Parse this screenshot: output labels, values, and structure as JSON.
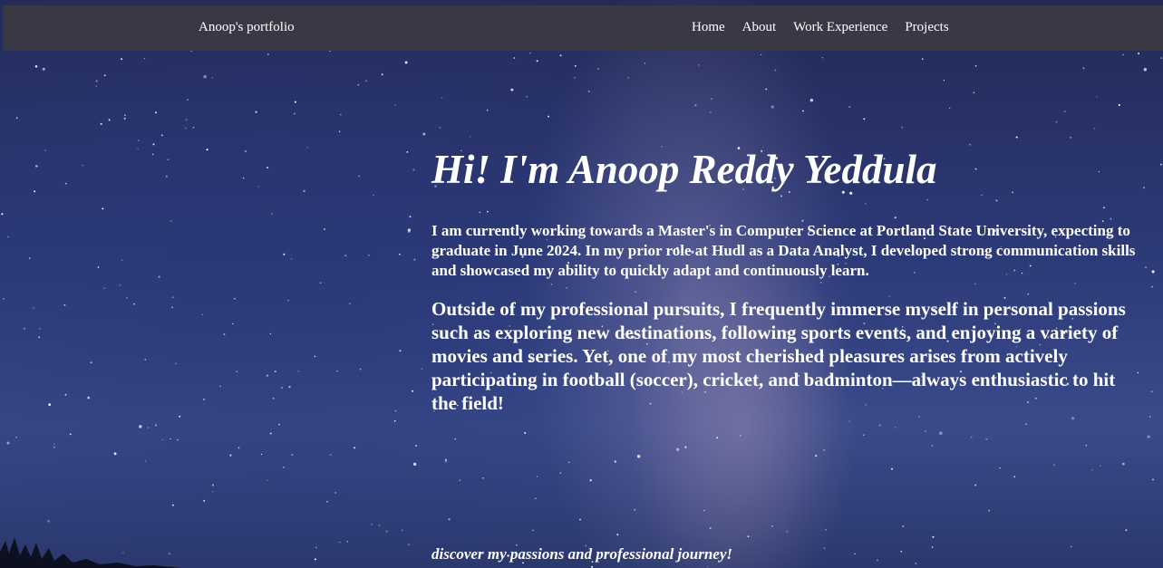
{
  "nav": {
    "brand": "Anoop's portfolio",
    "links": [
      "Home",
      "About",
      "Work Experience",
      "Projects"
    ]
  },
  "hero": {
    "title": "Hi! I'm Anoop Reddy Yeddula",
    "paragraph1": "I am currently working towards a Master's in Computer Science at Portland State University, expecting to graduate in June 2024. In my prior role at Hudl as a Data Analyst, I developed strong communication skills and showcased my ability to quickly adapt and continuously learn.",
    "paragraph2": "Outside of my professional pursuits, I frequently immerse myself in personal passions such as exploring new destinations, following sports events, and enjoying a variety of movies and series. Yet, one of my most cherished pleasures arises from actively participating in football (soccer), cricket, and badminton—always enthusiastic to hit the field!",
    "tagline": "discover my passions and professional journey!"
  },
  "colors": {
    "navbar": "#3a3845",
    "sky": "#2d3a78",
    "text": "#ffffff"
  }
}
